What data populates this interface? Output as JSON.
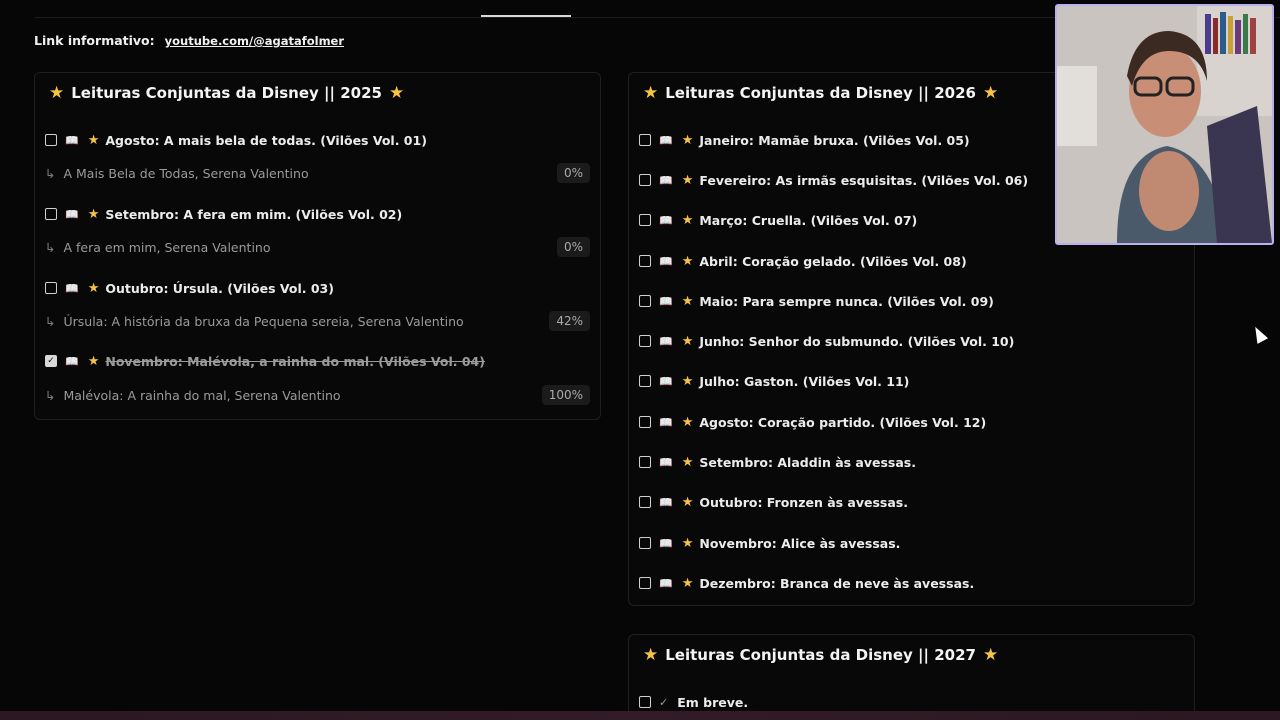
{
  "header": {
    "link_label": "Link informativo:",
    "link_url": "youtube.com/@agatafolmer"
  },
  "panel_2025": {
    "title": "Leituras Conjuntas da Disney || 2025",
    "tasks": [
      {
        "title": "Agosto: A mais bela de todas. (Vilões Vol. 01)",
        "book": "A Mais Bela de Todas, Serena Valentino",
        "progress": "0%",
        "checked": false
      },
      {
        "title": "Setembro: A fera em mim. (Vilões Vol. 02)",
        "book": "A fera em mim, Serena Valentino",
        "progress": "0%",
        "checked": false
      },
      {
        "title": "Outubro: Úrsula. (Vilões Vol. 03)",
        "book": "Úrsula: A história da bruxa da Pequena sereia, Serena Valentino",
        "progress": "42%",
        "checked": false
      },
      {
        "title": "Novembro: Malévola, a rainha do mal. (Vilões Vol. 04)",
        "book": "Malévola: A rainha do mal, Serena Valentino",
        "progress": "100%",
        "checked": true
      }
    ]
  },
  "panel_2026": {
    "title": "Leituras Conjuntas da Disney || 2026",
    "tasks": [
      {
        "title": "Janeiro: Mamãe bruxa. (Vilões Vol. 05)"
      },
      {
        "title": "Fevereiro: As irmãs esquisitas. (Vilões Vol. 06)"
      },
      {
        "title": "Março: Cruella. (Vilões Vol. 07)"
      },
      {
        "title": "Abril: Coração gelado. (Vilões Vol. 08)"
      },
      {
        "title": "Maio: Para sempre nunca. (Vilões Vol. 09)"
      },
      {
        "title": "Junho: Senhor do submundo. (Vilões Vol. 10)"
      },
      {
        "title": "Julho: Gaston. (Vilões Vol. 11)"
      },
      {
        "title": "Agosto: Coração partido. (Vilões Vol. 12)"
      },
      {
        "title": "Setembro: Aladdin às avessas."
      },
      {
        "title": "Outubro: Fronzen às avessas."
      },
      {
        "title": "Novembro: Alice às avessas."
      },
      {
        "title": "Dezembro: Branca de neve às avessas."
      }
    ]
  },
  "panel_2027": {
    "title": "Leituras Conjuntas da Disney || 2027",
    "tasks": [
      {
        "title": "Em breve."
      }
    ]
  },
  "icons": {
    "star": "★",
    "book": "📖",
    "arrow": "↳",
    "check": "✓"
  },
  "colors": {
    "star": "#f6c343",
    "webcam_border": "#b8b0f0"
  }
}
